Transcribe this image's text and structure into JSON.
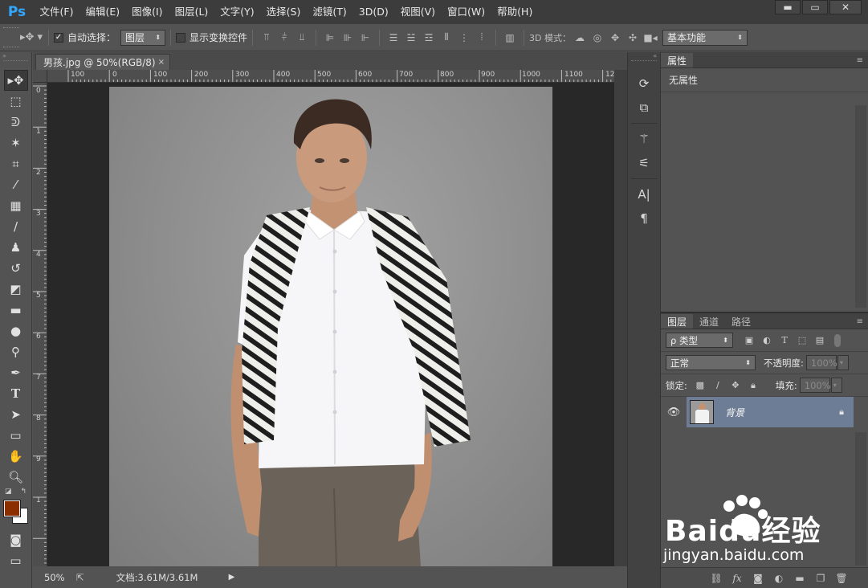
{
  "app": {
    "logo": "Ps"
  },
  "menu": [
    "文件(F)",
    "编辑(E)",
    "图像(I)",
    "图层(L)",
    "文字(Y)",
    "选择(S)",
    "滤镜(T)",
    "3D(D)",
    "视图(V)",
    "窗口(W)",
    "帮助(H)"
  ],
  "window_controls": {
    "minimize": "▬",
    "maximize": "▭",
    "close": "✕"
  },
  "options": {
    "auto_select_label": "自动选择：",
    "auto_select_checked": true,
    "auto_select_target": "图层",
    "show_transform_label": "显示变换控件",
    "mode_3d_label": "3D 模式：",
    "workspace": "基本功能"
  },
  "document": {
    "tab_title": "男孩.jpg @ 50%(RGB/8)",
    "close_glyph": "×",
    "zoom": "50%",
    "doc_info": "文档:3.61M/3.61M"
  },
  "ruler_h": [
    "100",
    "0",
    "100",
    "200",
    "300",
    "400",
    "500",
    "600",
    "700",
    "800",
    "900",
    "1000",
    "1100",
    "12"
  ],
  "ruler_v": [
    "0",
    "1",
    "2",
    "3",
    "4",
    "5",
    "6",
    "7",
    "8",
    "9",
    "1"
  ],
  "properties": {
    "tab": "属性",
    "content": "无属性"
  },
  "layers": {
    "tabs": [
      "图层",
      "通道",
      "路径"
    ],
    "filter_kind": "ρ 类型",
    "blend_mode": "正常",
    "opacity_label": "不透明度:",
    "opacity_value": "100%",
    "lock_label": "锁定:",
    "fill_label": "填充:",
    "fill_value": "100%",
    "items": [
      {
        "name": "背景",
        "visible": true,
        "locked": true
      }
    ]
  },
  "watermark": {
    "brand": "Baidu经验",
    "url": "jingyan.baidu.com"
  },
  "colors": {
    "foreground": "#8b2e00",
    "background": "#ffffff",
    "accent": "#31a8ff",
    "selected_layer": "#6d7d95"
  }
}
